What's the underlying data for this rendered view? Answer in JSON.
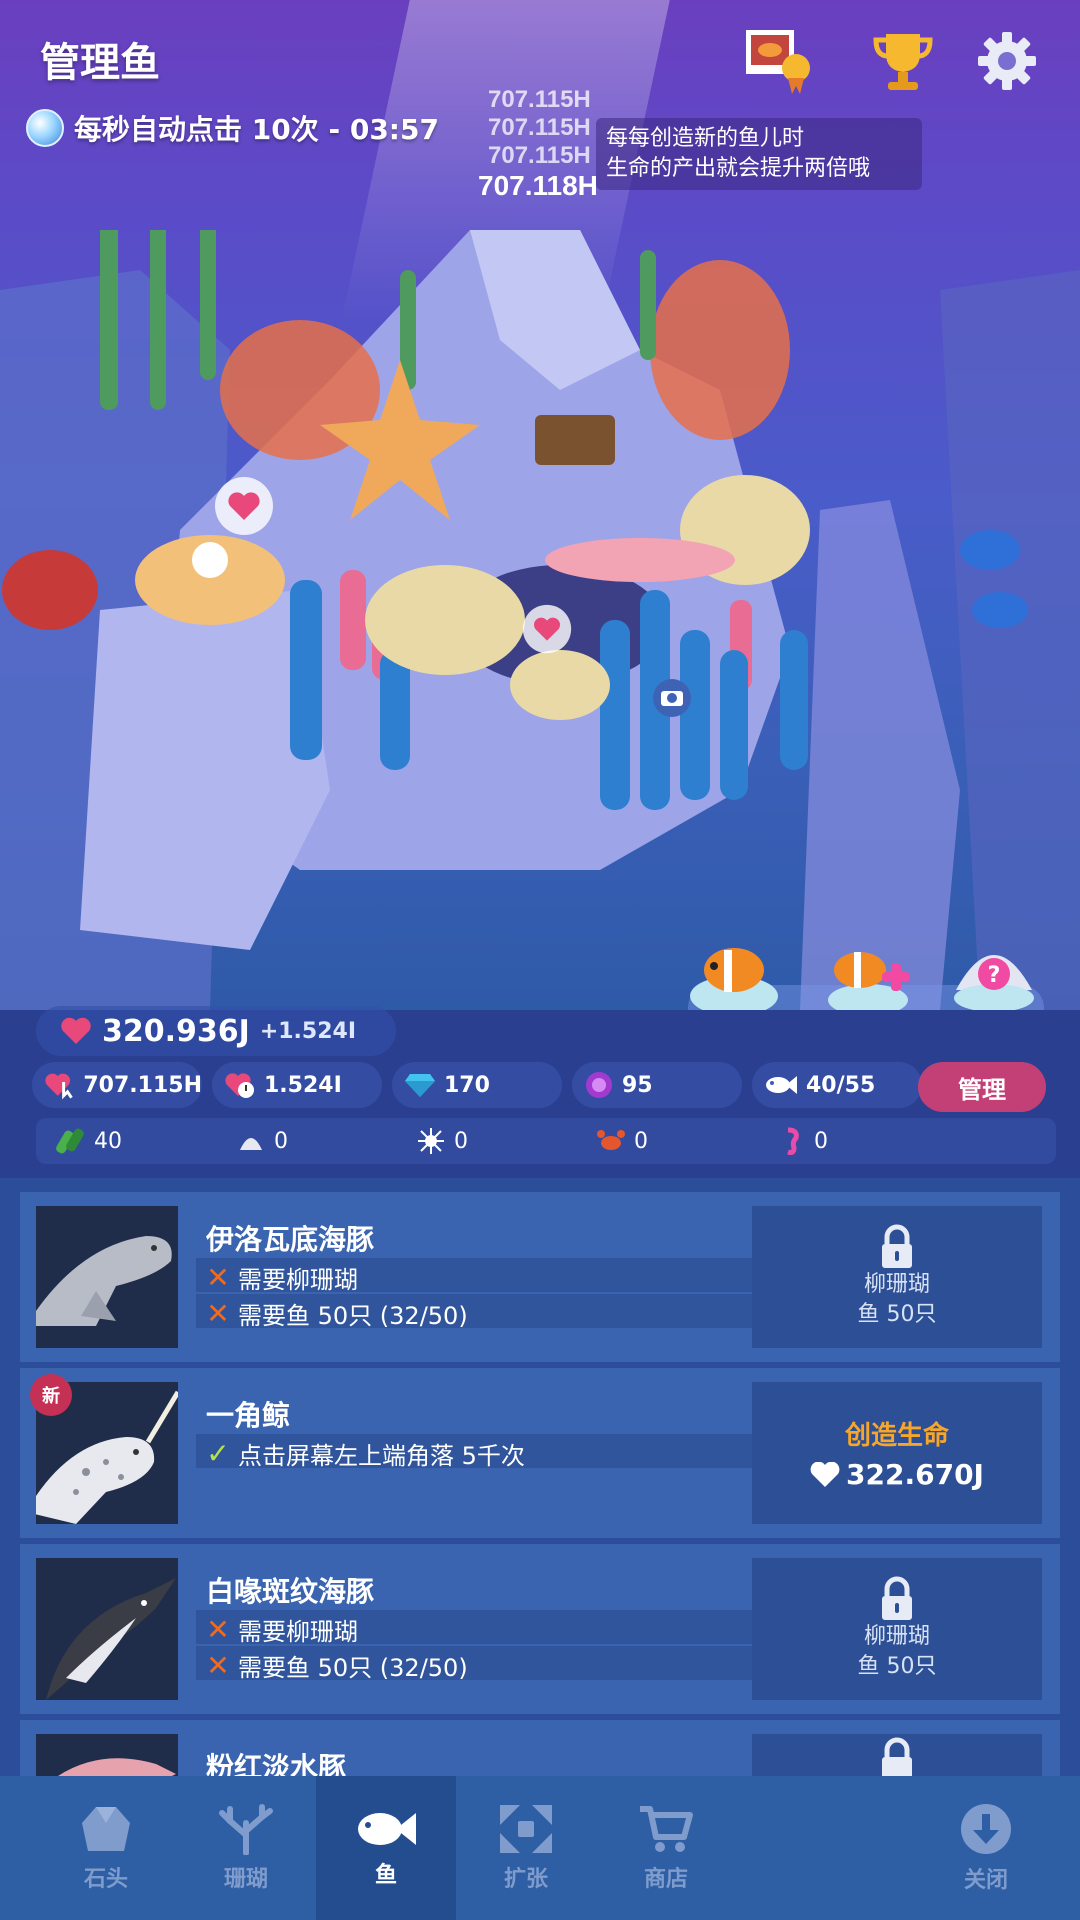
{
  "header": {
    "title": "管理鱼",
    "auto_tap": "每秒自动点击 10次 - 03:57",
    "tip_lines": [
      "每每创造新的鱼儿时",
      "生命的产出就会提升两倍哦"
    ],
    "floating_numbers": [
      "707.115H",
      "707.115H",
      "707.115H",
      "707.118H"
    ]
  },
  "stats": {
    "life_total": "320.936J",
    "life_rate": "+1.524I",
    "per_tap": "707.115H",
    "per_second": "1.524I",
    "gems": "170",
    "pearls": "95",
    "fish_count": "40/55",
    "manage_label": "管理",
    "resources": [
      {
        "icon": "seaweed-icon",
        "value": "40"
      },
      {
        "icon": "shell-icon",
        "value": "0"
      },
      {
        "icon": "urchin-icon",
        "value": "0"
      },
      {
        "icon": "crab-icon",
        "value": "0"
      },
      {
        "icon": "seahorse-icon",
        "value": "0"
      }
    ]
  },
  "fish_list": [
    {
      "name": "伊洛瓦底海豚",
      "requirements": [
        {
          "met": false,
          "text": "需要柳珊瑚"
        },
        {
          "met": false,
          "text": "需要鱼 50只 (32/50)"
        }
      ],
      "side_line1": "柳珊瑚",
      "side_line2": "鱼 50只"
    },
    {
      "name": "一角鲸",
      "badge": "新",
      "requirements": [
        {
          "met": true,
          "text": "点击屏幕左上端角落 5千次"
        }
      ],
      "create_label": "创造生命",
      "create_cost": "322.670J"
    },
    {
      "name": "白喙斑纹海豚",
      "requirements": [
        {
          "met": false,
          "text": "需要柳珊瑚"
        },
        {
          "met": false,
          "text": "需要鱼 50只 (32/50)"
        }
      ],
      "side_line1": "柳珊瑚",
      "side_line2": "鱼 50只"
    },
    {
      "name": "粉红淡水豚"
    }
  ],
  "tabs": [
    {
      "label": "石头",
      "icon": "rock-icon"
    },
    {
      "label": "珊瑚",
      "icon": "coral-icon"
    },
    {
      "label": "鱼",
      "icon": "fish-icon",
      "active": true
    },
    {
      "label": "扩张",
      "icon": "expand-icon"
    },
    {
      "label": "商店",
      "icon": "cart-icon"
    },
    {
      "label": "关闭",
      "icon": "close-down-icon"
    }
  ],
  "colors": {
    "accent_pink": "#c24076",
    "create_orange": "#f7a629",
    "cross_orange": "#f26a1b",
    "check_green": "#b8e34a",
    "new_badge": "#c53155"
  }
}
